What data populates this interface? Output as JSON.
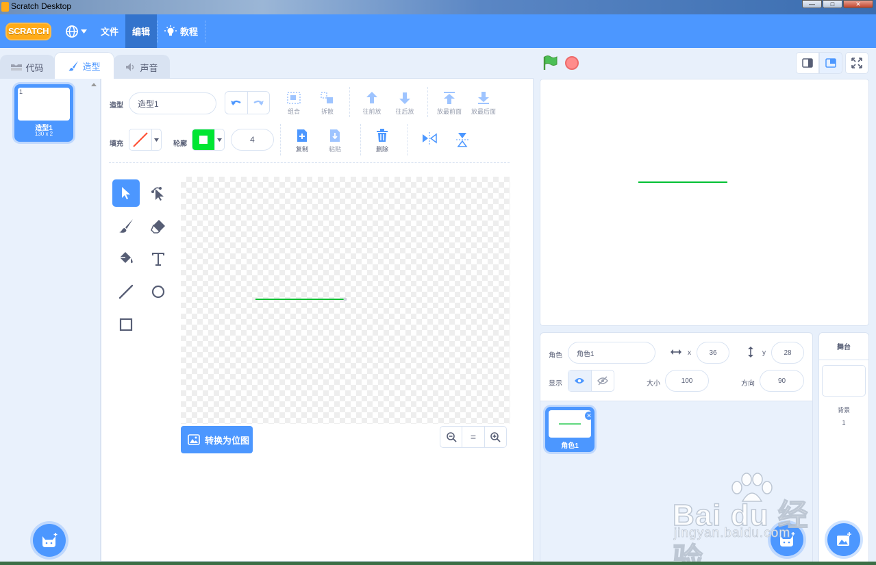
{
  "window": {
    "title": "Scratch Desktop"
  },
  "menubar": {
    "logo": "SCRATCH",
    "file": "文件",
    "edit": "编辑",
    "tutorials": "教程"
  },
  "tabs": {
    "code": "代码",
    "costumes": "造型",
    "sounds": "声音"
  },
  "costume_list": {
    "items": [
      {
        "number": "1",
        "name": "造型1",
        "size": "130 x 2"
      }
    ]
  },
  "editor": {
    "costume_label": "造型",
    "costume_name": "造型1",
    "group": "组合",
    "ungroup": "拆散",
    "forward": "往前放",
    "backward": "往后放",
    "front": "放最前面",
    "back": "放最后面",
    "fill_label": "填充",
    "outline_label": "轮廓",
    "outline_width": "4",
    "outline_color": "#00e632",
    "copy": "复制",
    "paste": "粘贴",
    "delete": "删除",
    "convert": "转换为位图",
    "zoom_reset": "="
  },
  "sprite": {
    "label_sprite": "角色",
    "name": "角色1",
    "x_label": "x",
    "x": "36",
    "y_label": "y",
    "y": "28",
    "show_label": "显示",
    "size_label": "大小",
    "size": "100",
    "direction_label": "方向",
    "direction": "90",
    "tiles": [
      {
        "name": "角色1"
      }
    ]
  },
  "stage_target": {
    "title": "舞台",
    "backdrop_label": "背景",
    "backdrop_count": "1"
  },
  "watermark": {
    "brand": "Bai du 经验",
    "url": "jingyan.baidu.com"
  },
  "colors": {
    "accent": "#4c97ff",
    "line": "#00c032",
    "fill_none": "#ff4c2f"
  }
}
